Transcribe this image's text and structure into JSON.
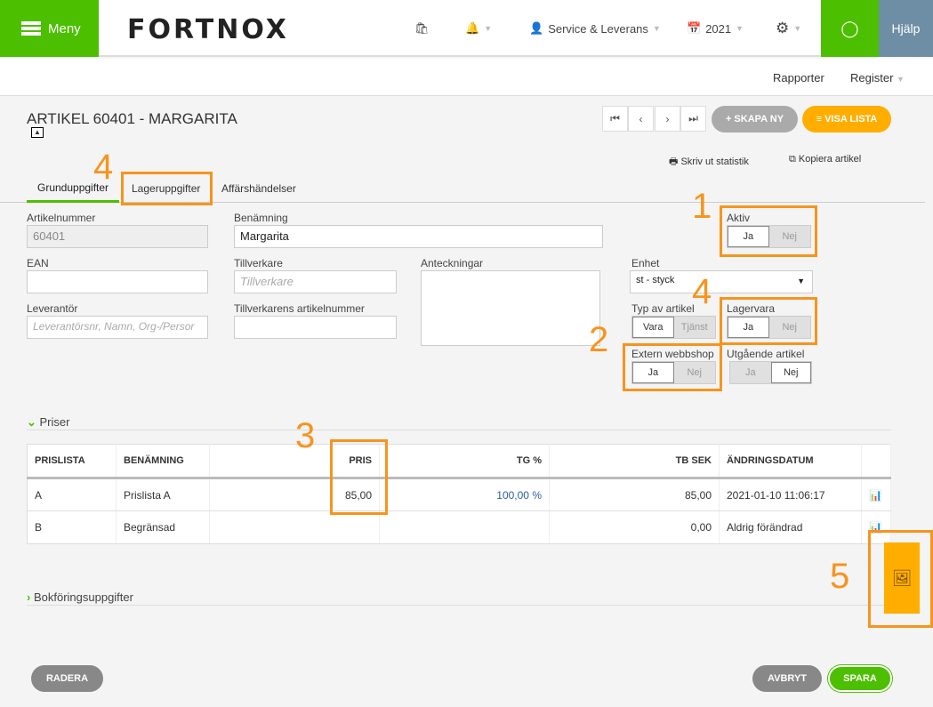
{
  "header": {
    "menu": "Meny",
    "logo": "FORTNOX",
    "company": "Service & Leverans",
    "year": "2021",
    "help": "Hjälp"
  },
  "subnav": {
    "reports": "Rapporter",
    "register": "Register"
  },
  "page": {
    "title": "ARTIKEL 60401 - MARGARITA",
    "create": "SKAPA NY",
    "list": "VISA LISTA",
    "print": "Skriv ut statistik",
    "copy": "Kopiera artikel"
  },
  "tabs": [
    "Grunduppgifter",
    "Lageruppgifter",
    "Affärshändelser"
  ],
  "form": {
    "artikelnummer": {
      "label": "Artikelnummer",
      "value": "60401"
    },
    "benamning": {
      "label": "Benämning",
      "value": "Margarita"
    },
    "ean": {
      "label": "EAN"
    },
    "tillverkare": {
      "label": "Tillverkare",
      "placeholder": "Tillverkare"
    },
    "anteckningar": {
      "label": "Anteckningar"
    },
    "leverantor": {
      "label": "Leverantör",
      "placeholder": "Leverantörsnr, Namn, Org-/Persor"
    },
    "tillv_artnr": {
      "label": "Tillverkarens artikelnummer"
    },
    "enhet": {
      "label": "Enhet",
      "value": "st - styck"
    },
    "aktiv": {
      "label": "Aktiv",
      "yes": "Ja",
      "no": "Nej"
    },
    "typ": {
      "label": "Typ av artikel",
      "a": "Vara",
      "b": "Tjänst"
    },
    "lagervara": {
      "label": "Lagervara",
      "yes": "Ja",
      "no": "Nej"
    },
    "webbshop": {
      "label": "Extern webbshop",
      "yes": "Ja",
      "no": "Nej"
    },
    "utgaende": {
      "label": "Utgående artikel",
      "yes": "Ja",
      "no": "Nej"
    }
  },
  "prices": {
    "section": "Priser",
    "headers": [
      "PRISLISTA",
      "BENÄMNING",
      "PRIS",
      "TG %",
      "TB SEK",
      "ÄNDRINGSDATUM"
    ],
    "rows": [
      [
        "A",
        "Prislista A",
        "85,00",
        "100,00 %",
        "85,00",
        "2021-01-10 11:06:17"
      ],
      [
        "B",
        "Begränsad",
        "",
        "",
        "0,00",
        "Aldrig förändrad"
      ]
    ]
  },
  "bookkeeping": "Bokföringsuppgifter",
  "footer": {
    "delete": "RADERA",
    "cancel": "AVBRYT",
    "save": "SPARA"
  },
  "annotations": [
    "1",
    "2",
    "3",
    "4",
    "4",
    "5"
  ]
}
